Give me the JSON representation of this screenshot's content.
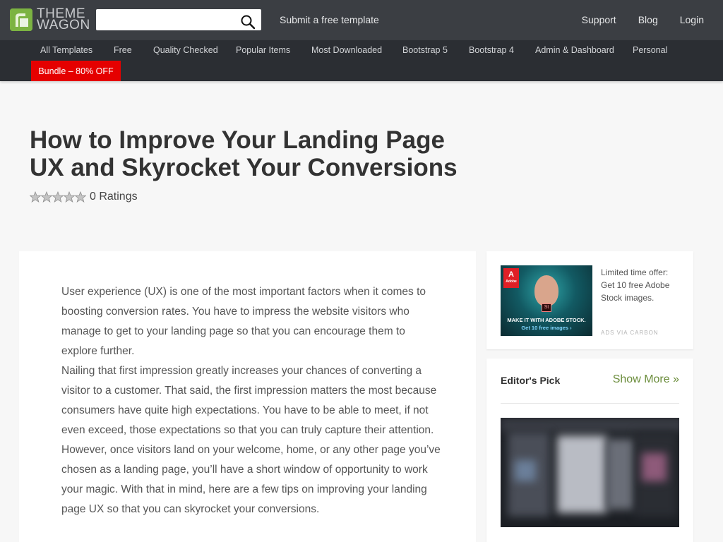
{
  "header": {
    "logo": {
      "line1": "THEME",
      "line2": "WAGON"
    },
    "search": {
      "value": "",
      "placeholder": ""
    },
    "submit_link": "Submit a free template",
    "links": [
      "Support",
      "Blog",
      "Login"
    ]
  },
  "nav": {
    "items": [
      "All Templates",
      "Free",
      "Quality Checked",
      "Popular Items",
      "Most Downloaded",
      "Bootstrap 5",
      "Bootstrap 4",
      "Admin & Dashboard",
      "Personal"
    ],
    "bundle": "Bundle – 80% OFF"
  },
  "post": {
    "title_line1": "How to Improve Your Landing Page",
    "title_line2": "UX and Skyrocket Your Conversions",
    "rating_value": 0,
    "rating_max": 5,
    "rating_text": "0 Ratings",
    "paragraphs": [
      "User experience (UX) is one of the most important factors when it comes to boosting conversion rates. You have to impress the website visitors who manage to get to your landing page so that you can encourage them to explore further.",
      "Nailing that first impression greatly increases your chances of converting a visitor to a customer. That said, the first impression matters the most because consumers have quite high expectations. You have to be able to meet, if not even exceed, those expectations so that you can truly capture their attention.",
      "However, once visitors land on your welcome, home, or any other page you’ve chosen as a landing page, you’ll have a short window of opportunity to work your magic. With that in mind, here are a few tips on improving your landing page UX so that you can skyrocket your conversions."
    ]
  },
  "ad": {
    "brand": "Adobe",
    "brand_mark": "A",
    "app_badge": "St",
    "headline": "MAKE IT WITH ADOBE STOCK.",
    "subline": "Get 10 free images ›",
    "text": "Limited time offer: Get 10 free Adobe Stock images.",
    "via": "ADS VIA CARBON"
  },
  "editors_pick": {
    "title": "Editor's Pick",
    "more": "Show More »"
  },
  "colors": {
    "header_bg": "#3b3e43",
    "nav_bg": "#2b2e33",
    "bundle_bg": "#e50000",
    "accent_green": "#6a8c3a",
    "logo_green": "#7cb342"
  },
  "icons": [
    "theme-wagon-logo-icon",
    "search-icon",
    "star-icon",
    "adobe-logo-icon"
  ]
}
